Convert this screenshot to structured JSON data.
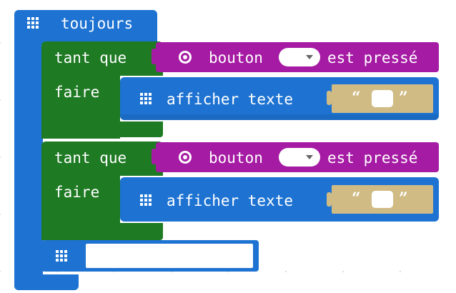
{
  "forever_block": {
    "label": "toujours",
    "icon": "grid-icon"
  },
  "while_blocks": [
    {
      "while_label": "tant que",
      "do_label": "faire",
      "condition": {
        "icon": "radio-icon",
        "prefix": "bouton",
        "dropdown_value": "",
        "suffix": "est pressé"
      },
      "action": {
        "icon": "grid-icon",
        "label": "afficher texte",
        "open_quote": "“",
        "close_quote": "”",
        "value": ""
      }
    },
    {
      "while_label": "tant que",
      "do_label": "faire",
      "condition": {
        "icon": "radio-icon",
        "prefix": "bouton",
        "dropdown_value": "",
        "suffix": "est pressé"
      },
      "action": {
        "icon": "grid-icon",
        "label": "afficher texte",
        "open_quote": "“",
        "close_quote": "”",
        "value": ""
      }
    }
  ],
  "trailing_block": {
    "icon": "grid-icon",
    "input_value": ""
  },
  "colors": {
    "basic": "#1e73d2",
    "loops": "#1f7a24",
    "input": "#a51ba3",
    "text": "#d0bb85"
  }
}
